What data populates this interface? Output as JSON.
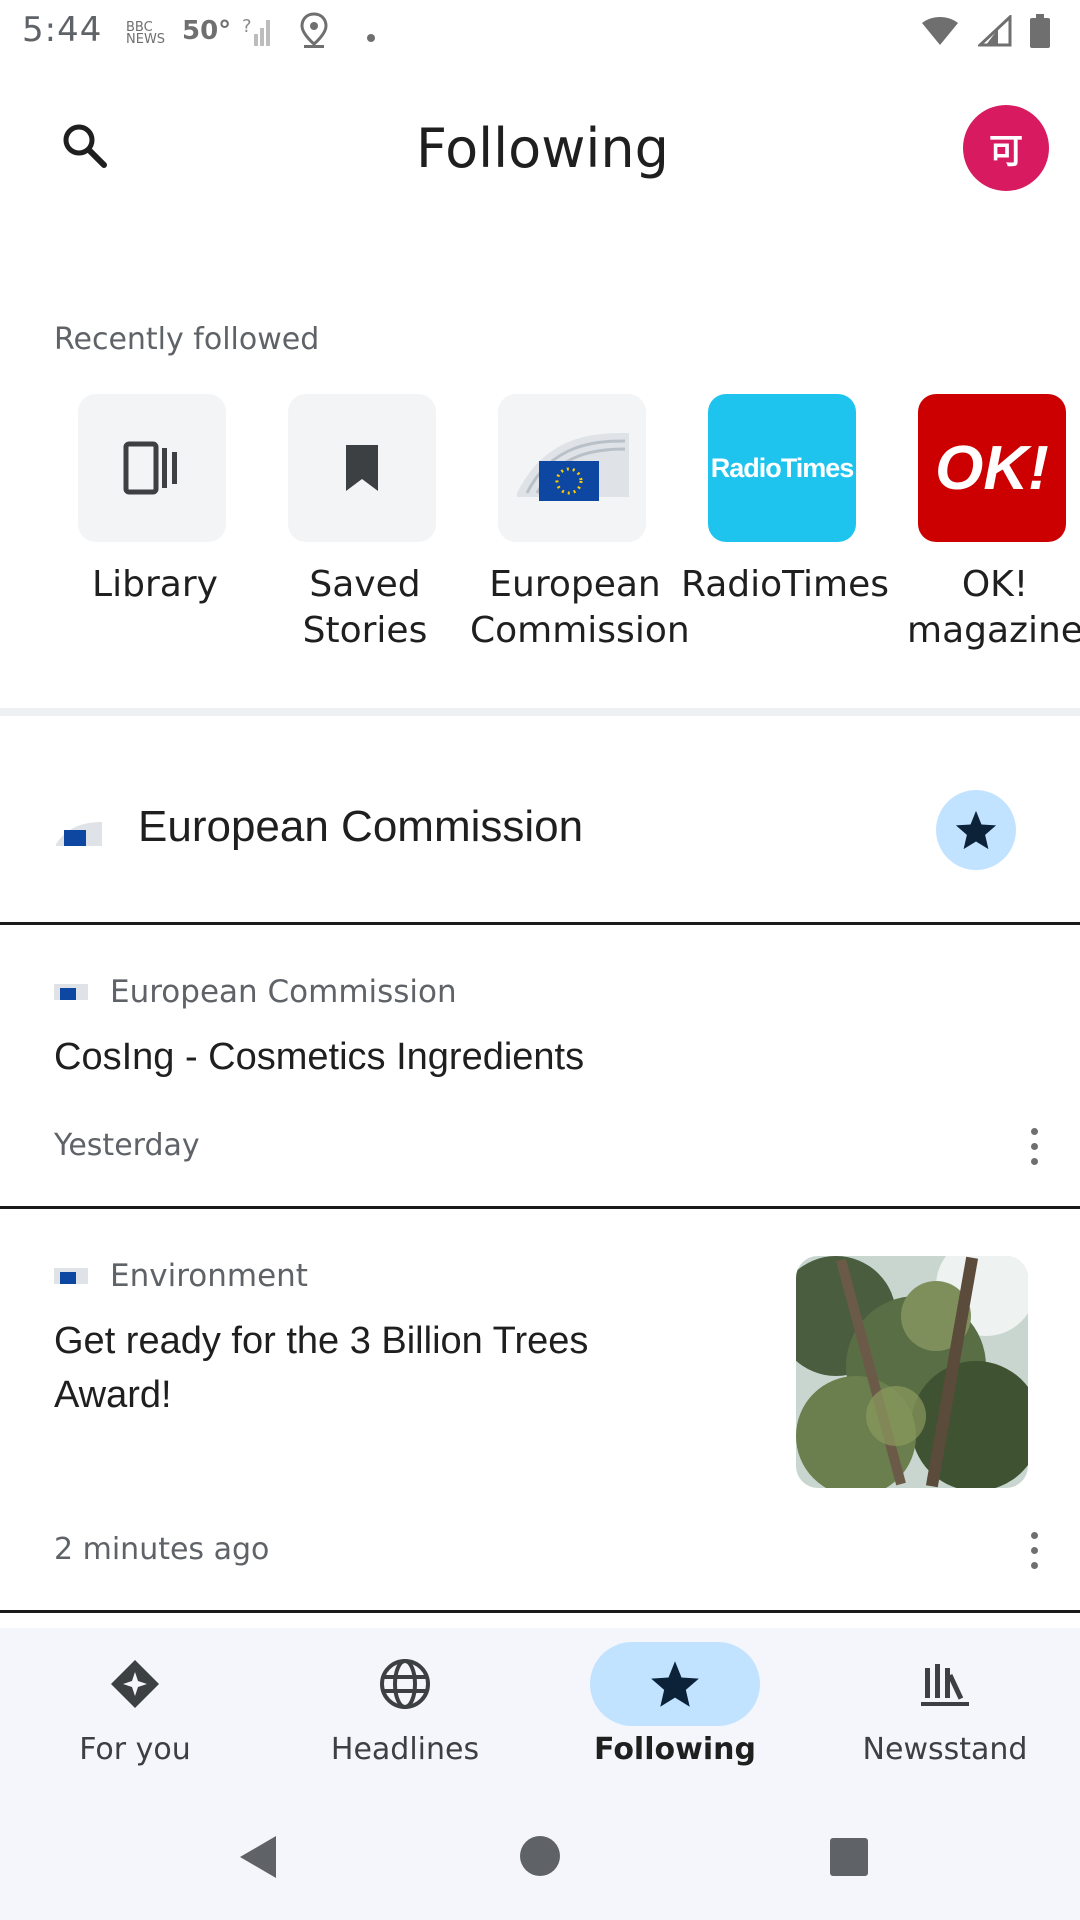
{
  "status_bar": {
    "time": "5:44",
    "temperature": "50°",
    "news_badge": "NEWS"
  },
  "header": {
    "title": "Following",
    "avatar_initial": "可",
    "avatar_color": "#d81b60"
  },
  "recently_followed": {
    "label": "Recently followed",
    "items": [
      {
        "label": "Library",
        "icon": "library-icon"
      },
      {
        "label": "Saved Stories",
        "icon": "bookmark-icon"
      },
      {
        "label": "European Commission",
        "icon": "eu-commission-logo"
      },
      {
        "label": "RadioTimes",
        "icon": "radiotimes-logo",
        "logo_text": "RadioTimes",
        "color": "#1fc4ee"
      },
      {
        "label": "OK! magazine",
        "icon": "ok-magazine-logo",
        "logo_text": "OK!",
        "color": "#cc0000"
      }
    ]
  },
  "source": {
    "name": "European Commission",
    "followed": true
  },
  "articles": [
    {
      "source": "European Commission",
      "title": "CosIng - Cosmetics Ingredients",
      "time": "Yesterday"
    },
    {
      "source": "Environment",
      "title": "Get ready for the 3 Billion Trees Award!",
      "time": "2 minutes ago",
      "thumbnail": "trees-image"
    }
  ],
  "bottom_nav": {
    "tabs": [
      {
        "label": "For you",
        "icon": "for-you-icon",
        "active": false
      },
      {
        "label": "Headlines",
        "icon": "globe-icon",
        "active": false
      },
      {
        "label": "Following",
        "icon": "star-icon",
        "active": true
      },
      {
        "label": "Newsstand",
        "icon": "newsstand-icon",
        "active": false
      }
    ]
  },
  "colors": {
    "accent": "#c2e3ff",
    "star": "#0b2239",
    "nav_bg": "#f4f6fb"
  }
}
